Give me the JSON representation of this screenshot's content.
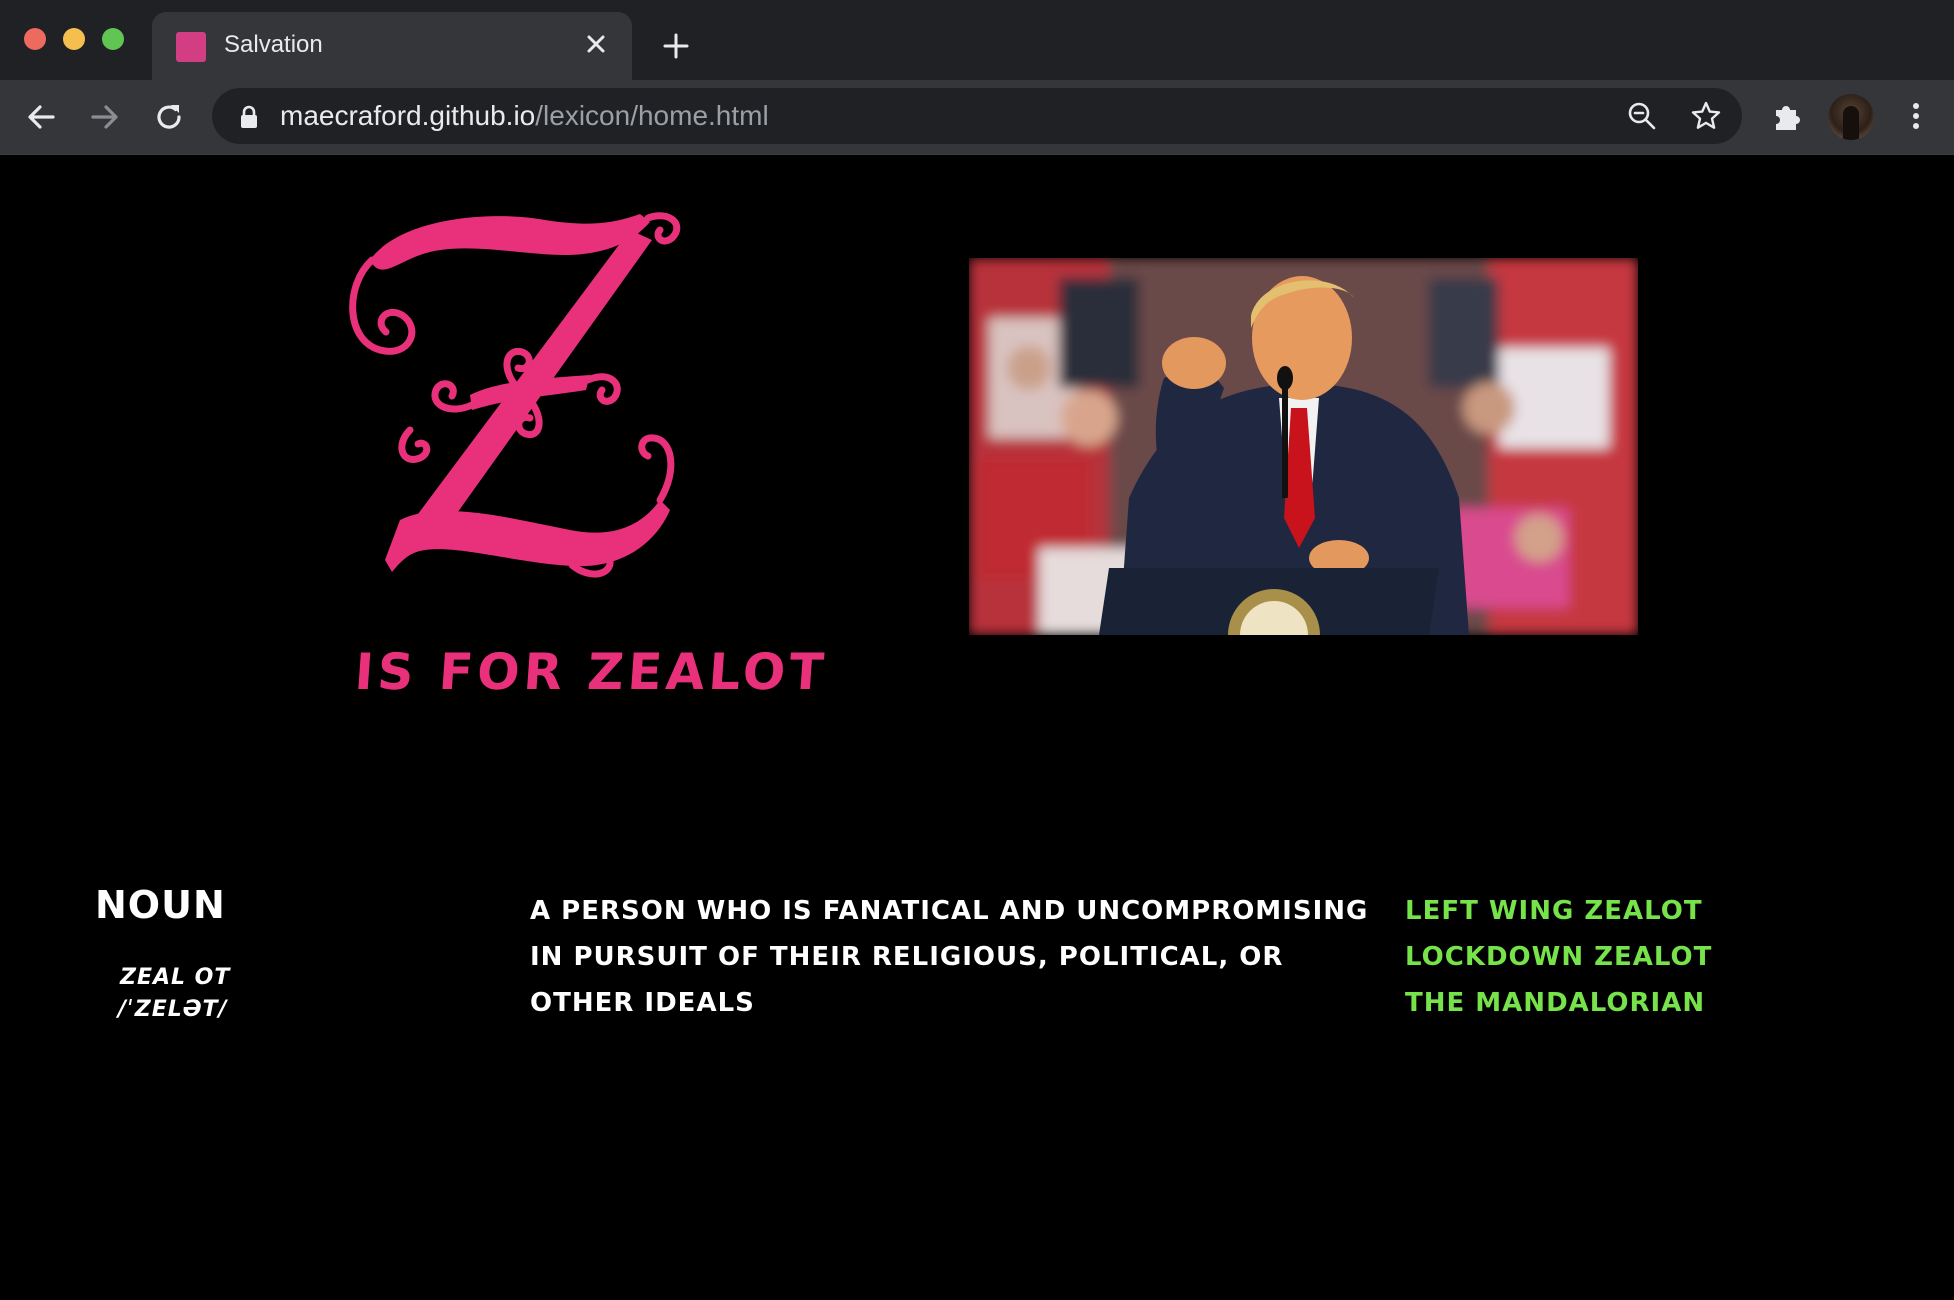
{
  "browser": {
    "tab": {
      "title": "Salvation",
      "favicon_color": "#d23d84"
    },
    "address": {
      "host": "maecraford.github.io",
      "path": "/lexicon/home.html"
    },
    "icons": [
      "back-icon",
      "forward-icon",
      "reload-icon",
      "lock-icon",
      "zoom-icon",
      "star-icon",
      "extensions-icon",
      "profile-avatar",
      "menu-icon"
    ]
  },
  "page": {
    "letter_glyph": "Z",
    "headline": "is for zealot",
    "part_of_speech": "Noun",
    "syllables": "zeal ot",
    "pronunciation": "/ˈzelət/",
    "definition": "A person who is fanatical and uncompromising in pursuit of their religious, political, or other ideals",
    "related_links": [
      {
        "label": "Left wing zealot"
      },
      {
        "label": "Lockdown zealot"
      },
      {
        "label": "The Mandalorian"
      }
    ],
    "colors": {
      "accent_pink": "#e8317a",
      "link_green": "#76e34a",
      "background": "#000000"
    }
  }
}
